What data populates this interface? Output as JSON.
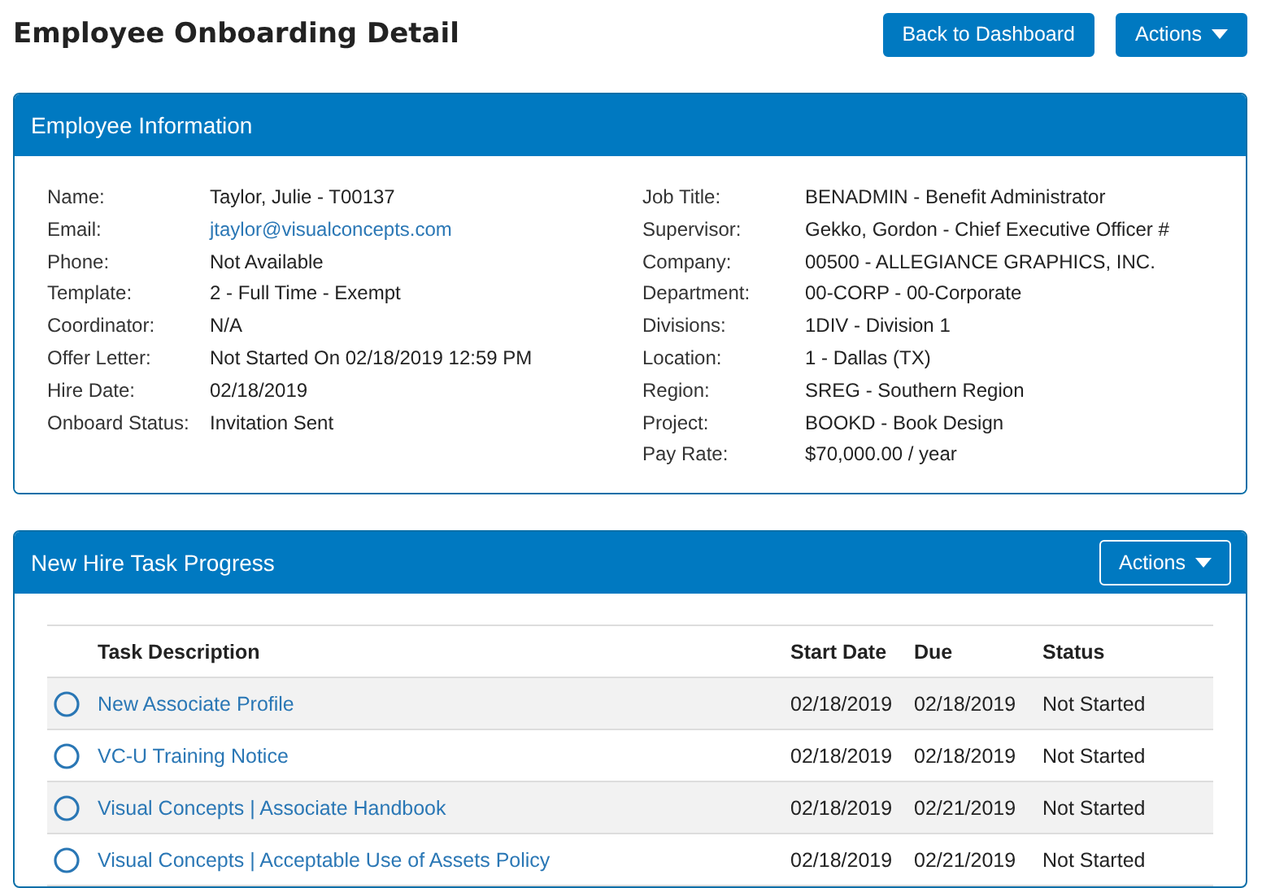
{
  "page_title": "Employee Onboarding Detail",
  "header_buttons": [
    {
      "label": "Back to Dashboard",
      "kind": "plain"
    },
    {
      "label": "Actions",
      "kind": "dropdown"
    }
  ],
  "employee_information": {
    "title": "Employee Information",
    "left_fields": [
      {
        "label": "Name:",
        "value": "Taylor, Julie - T00137",
        "kind": "text"
      },
      {
        "label": "Email:",
        "value": "jtaylor@visualconcepts.com",
        "kind": "link"
      },
      {
        "label": "Phone:",
        "value": "Not Available",
        "kind": "text"
      },
      {
        "label": "Template:",
        "value": "2 - Full Time - Exempt",
        "kind": "text"
      },
      {
        "label": "Coordinator:",
        "value": "N/A",
        "kind": "text"
      },
      {
        "label": "Offer Letter:",
        "value": "Not Started On 02/18/2019 12:59 PM",
        "kind": "text"
      },
      {
        "label": "Hire Date:",
        "value": "02/18/2019",
        "kind": "text"
      },
      {
        "label": "Onboard Status:",
        "value": "Invitation Sent",
        "kind": "text"
      }
    ],
    "right_fields": [
      {
        "label": "Job Title:",
        "value": "BENADMIN - Benefit Administrator",
        "kind": "text"
      },
      {
        "label": "Supervisor:",
        "value": "Gekko, Gordon - Chief Executive Officer #",
        "kind": "text"
      },
      {
        "label": "Company:",
        "value": "00500 - ALLEGIANCE GRAPHICS, INC.",
        "kind": "text"
      },
      {
        "label": "Department:",
        "value": "00-CORP - 00-Corporate",
        "kind": "text"
      },
      {
        "label": "Divisions:",
        "value": "1DIV - Division 1",
        "kind": "text"
      },
      {
        "label": "Location:",
        "value": "1 - Dallas (TX)",
        "kind": "text"
      },
      {
        "label": "Region:",
        "value": "SREG - Southern Region",
        "kind": "text"
      },
      {
        "label": "Project:",
        "value": "BOOKD - Book Design",
        "kind": "text"
      },
      {
        "label": "Pay Rate:",
        "value": "$70,000.00 / year",
        "kind": "text"
      }
    ]
  },
  "task_progress": {
    "title": "New Hire Task Progress",
    "actions_button": "Actions",
    "columns": [
      "Task Description",
      "Start Date",
      "Due",
      "Status"
    ],
    "rows": [
      {
        "task": "New Associate Profile",
        "start_date": "02/18/2019",
        "due": "02/18/2019",
        "status": "Not Started",
        "done": false
      },
      {
        "task": "VC-U Training Notice",
        "start_date": "02/18/2019",
        "due": "02/18/2019",
        "status": "Not Started",
        "done": false
      },
      {
        "task": "Visual Concepts | Associate Handbook",
        "start_date": "02/18/2019",
        "due": "02/21/2019",
        "status": "Not Started",
        "done": false
      },
      {
        "task": "Visual Concepts | Acceptable Use of Assets Policy",
        "start_date": "02/18/2019",
        "due": "02/21/2019",
        "status": "Not Started",
        "done": false
      }
    ]
  }
}
